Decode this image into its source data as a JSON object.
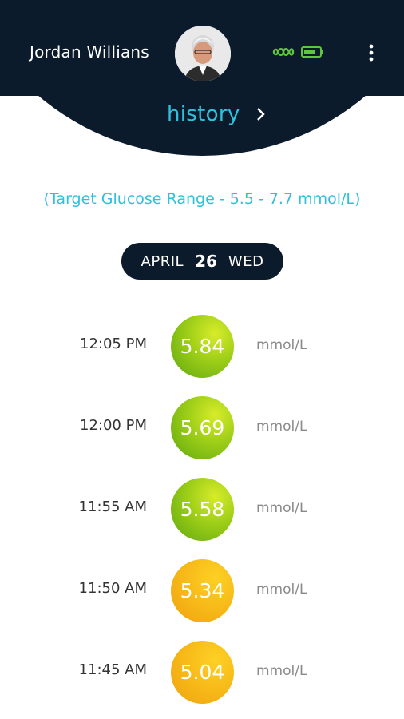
{
  "header": {
    "user_name": "Jordan Willians",
    "history_label": "history",
    "connection_icon": "infinity-link-icon",
    "battery_icon": "battery-icon",
    "colors": {
      "background": "#0c1b2c",
      "accent": "#30c0dc",
      "status_green": "#5ec63a"
    }
  },
  "target_range": "(Target Glucose Range - 5.5 - 7.7 mmol/L)",
  "date": {
    "month": "APRIL",
    "day": "26",
    "weekday": "WED"
  },
  "readings": [
    {
      "time": "12:05 PM",
      "value": "5.84",
      "unit": "mmol/L",
      "color": "#8cc41a"
    },
    {
      "time": "12:00 PM",
      "value": "5.69",
      "unit": "mmol/L",
      "color": "#8cc41a"
    },
    {
      "time": "11:55 AM",
      "value": "5.58",
      "unit": "mmol/L",
      "color": "#8cc41a"
    },
    {
      "time": "11:50 AM",
      "value": "5.34",
      "unit": "mmol/L",
      "color": "#f5b418"
    },
    {
      "time": "11:45 AM",
      "value": "5.04",
      "unit": "mmol/L",
      "color": "#f5b418"
    }
  ]
}
